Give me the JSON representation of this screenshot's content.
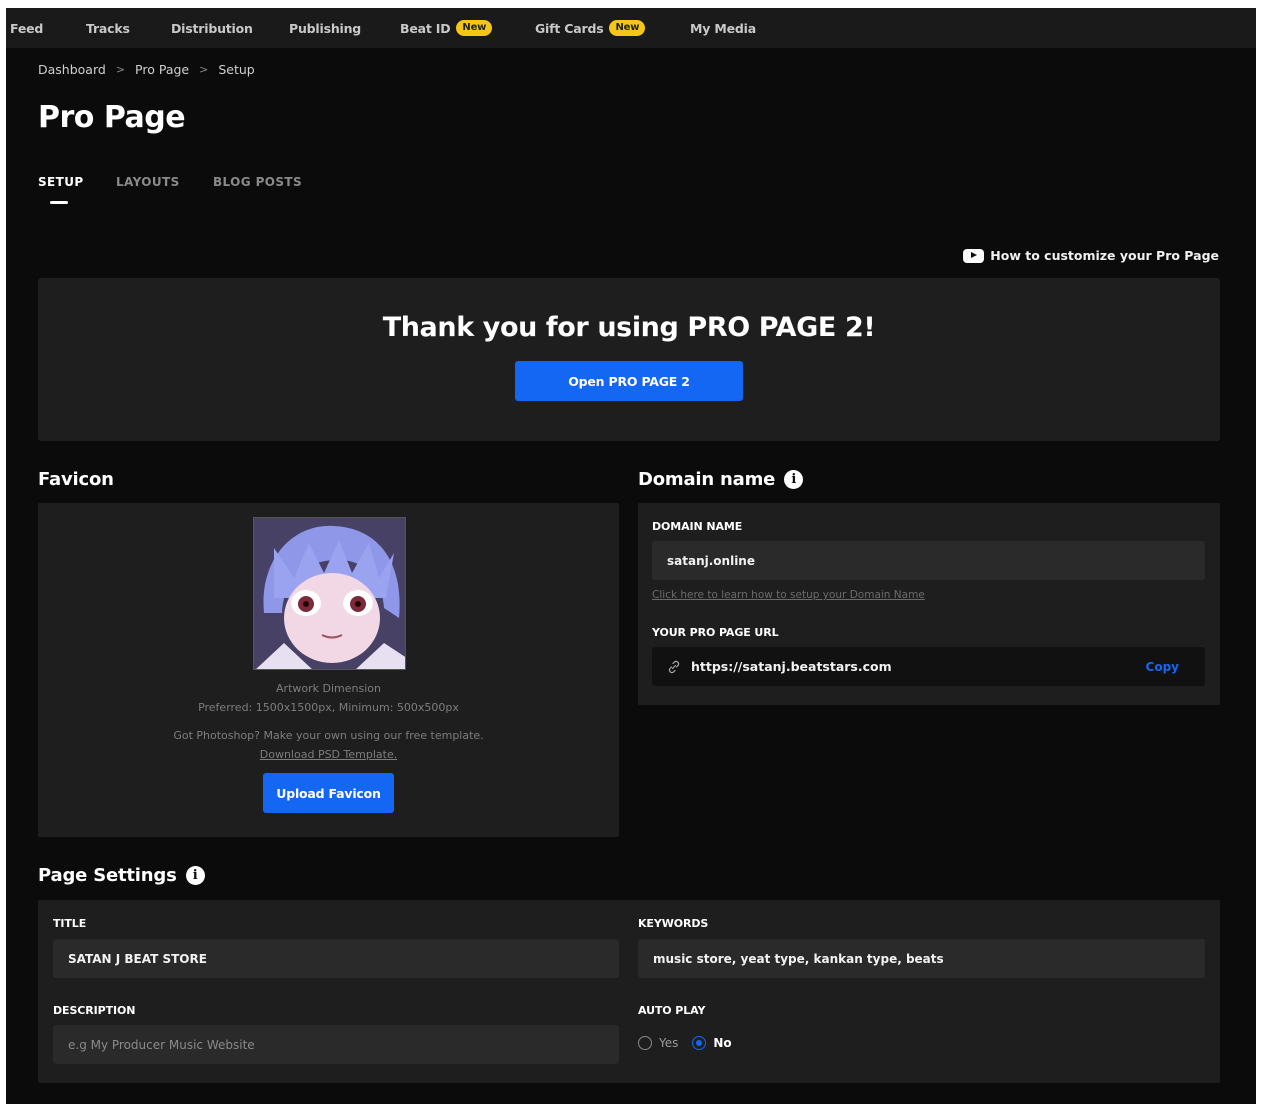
{
  "nav": {
    "items": [
      {
        "label": "Feed"
      },
      {
        "label": "Tracks"
      },
      {
        "label": "Distribution"
      },
      {
        "label": "Publishing"
      },
      {
        "label": "Beat ID",
        "badge": "New"
      },
      {
        "label": "Gift Cards",
        "badge": "New"
      },
      {
        "label": "My Media"
      }
    ]
  },
  "breadcrumb": [
    "Dashboard",
    "Pro Page",
    "Setup"
  ],
  "breadcrumb_separator": ">",
  "page_title": "Pro Page",
  "tabs": [
    {
      "label": "SETUP",
      "active": true
    },
    {
      "label": "LAYOUTS",
      "active": false
    },
    {
      "label": "BLOG POSTS",
      "active": false
    }
  ],
  "howto_link": "How to customize your Pro Page",
  "promo": {
    "title": "Thank you for using PRO PAGE 2!",
    "button": "Open PRO PAGE 2"
  },
  "favicon": {
    "heading": "Favicon",
    "artwork_label": "Artwork Dimension",
    "artwork_dims": "Preferred: 1500x1500px, Minimum: 500x500px",
    "photoshop_text": "Got Photoshop? Make your own using our free template.",
    "download_link": "Download PSD Template.",
    "upload_button": "Upload Favicon"
  },
  "domain": {
    "heading": "Domain name",
    "domain_label": "DOMAIN NAME",
    "domain_value": "satanj.online",
    "help_link": "Click here to learn how to setup your Domain Name",
    "url_label": "YOUR PRO PAGE URL",
    "url_value": "https://satanj.beatstars.com",
    "copy_label": "Copy"
  },
  "page_settings": {
    "heading": "Page Settings",
    "title_label": "TITLE",
    "title_value": "SATAN J BEAT STORE",
    "keywords_label": "KEYWORDS",
    "keywords_value": "music store, yeat type, kankan type, beats",
    "description_label": "DESCRIPTION",
    "description_placeholder": "e.g My Producer Music Website",
    "autoplay_label": "AUTO PLAY",
    "autoplay_options": [
      "Yes",
      "No"
    ],
    "autoplay_selected": "No"
  },
  "colors": {
    "background": "#0b0b0b",
    "panel": "#1e1e1e",
    "accent_blue": "#1467f2",
    "badge_yellow": "#f5c518"
  },
  "icons": [
    "youtube-play-icon",
    "info-icon",
    "link-icon"
  ]
}
